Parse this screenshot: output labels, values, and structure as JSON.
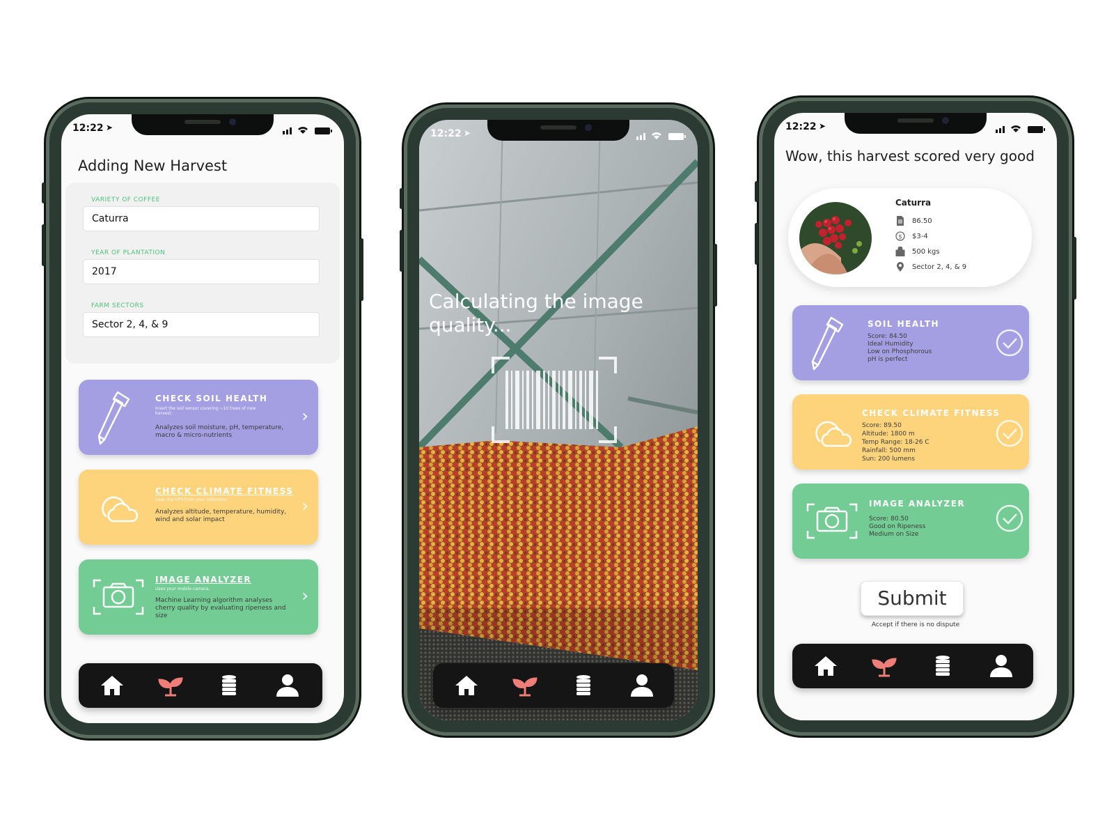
{
  "status_time": "12:22",
  "colors": {
    "purple": "#a49fe3",
    "yellow": "#fdd37c",
    "green": "#74cc95",
    "accent_text": "#4cc17a",
    "nav_bg": "#151515",
    "active_icon": "#ef7d78"
  },
  "nav": [
    {
      "icon": "home-icon",
      "label": "Home"
    },
    {
      "icon": "sprout-icon",
      "label": "Harvest",
      "active": true
    },
    {
      "icon": "coins-icon",
      "label": "Ledger"
    },
    {
      "icon": "user-icon",
      "label": "Profile"
    }
  ],
  "screen1": {
    "title": "Adding New Harvest",
    "fields": [
      {
        "label": "VARIETY OF COFFEE",
        "value": "Caturra"
      },
      {
        "label": "YEAR OF PLANTATION",
        "value": "2017"
      },
      {
        "label": "FARM SECTORS",
        "value": "Sector 2, 4, & 9"
      }
    ],
    "cards": [
      {
        "title": "CHECK SOIL HEALTH",
        "note": "Insert the soil sensor covering ~10 trees of new harvest.",
        "desc": "Analyzes soil moisture, pH, temperature, macro & micro-nutrients",
        "icon": "soil-sensor-icon"
      },
      {
        "title": "CHECK CLIMATE FITNESS",
        "note": "Uses the GPS from your cellphone.",
        "desc": "Analyzes altitude, temperature, humidity, wind and solar impact",
        "icon": "cloud-icon"
      },
      {
        "title": "IMAGE ANALYZER",
        "note": "Uses your mobile camera.",
        "desc": "Machine Learning algorithm analyses cherry quality by evaluating ripeness and size",
        "icon": "camera-icon"
      }
    ]
  },
  "screen2": {
    "caption": "Calculating the image quality...",
    "icon": "barcode-scan-icon"
  },
  "screen3": {
    "title": "Wow, this harvest scored very good",
    "product": {
      "name": "Caturra",
      "rows": [
        {
          "icon": "document-icon",
          "text": "86.50"
        },
        {
          "icon": "dollar-icon",
          "text": "$3-4"
        },
        {
          "icon": "bag-icon",
          "text": "500 kgs"
        },
        {
          "icon": "location-pin-icon",
          "text": "Sector 2, 4, & 9"
        }
      ]
    },
    "results": [
      {
        "title": "SOIL HEALTH",
        "lines": [
          "Score: 84.50",
          "Ideal Humidity",
          "Low on Phosphorous",
          "pH is perfect"
        ]
      },
      {
        "title": "CHECK CLIMATE FITNESS",
        "lines": [
          "Score: 89.50",
          "Altitude: 1800 m",
          "Temp Range: 18-26 C",
          "Rainfall: 500 mm",
          "Sun: 200 lumens"
        ]
      },
      {
        "title": "IMAGE ANALYZER",
        "lines": [
          "Score: 80.50",
          "Good on Ripeness",
          "Medium on Size"
        ]
      }
    ],
    "submit_label": "Submit",
    "accept_note": "Accept if there is no dispute"
  }
}
